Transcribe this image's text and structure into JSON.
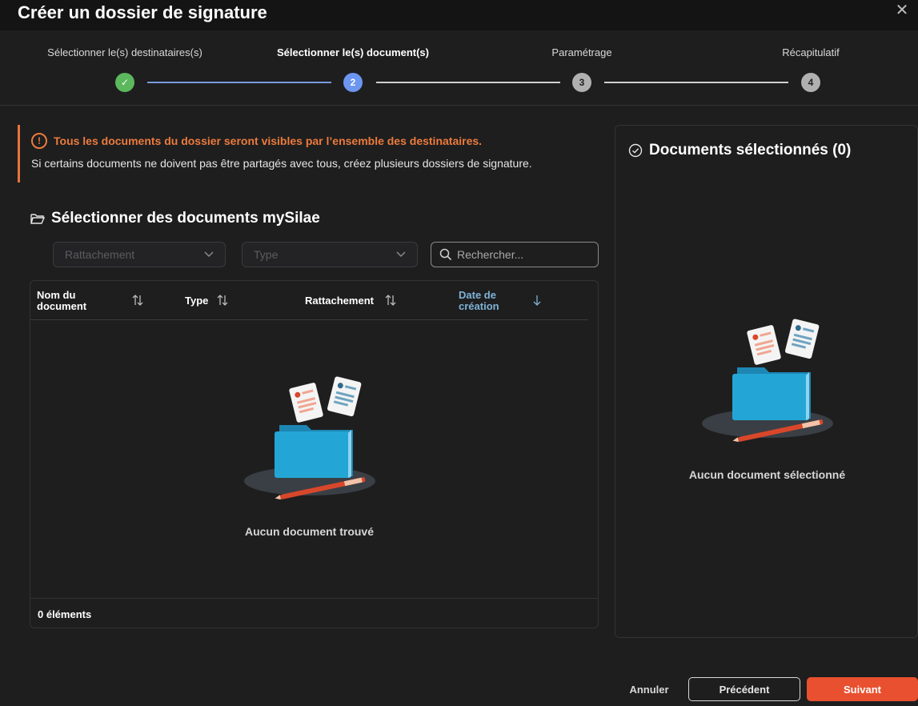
{
  "window": {
    "title": "Créer un dossier de signature",
    "close_icon": "close-icon"
  },
  "stepper": {
    "steps": [
      {
        "label": "Sélectionner le(s) destinataires(s)",
        "marker": "✓",
        "state": "done"
      },
      {
        "label": "Sélectionner le(s) document(s)",
        "marker": "2",
        "state": "active"
      },
      {
        "label": "Paramétrage",
        "marker": "3",
        "state": "todo"
      },
      {
        "label": "Récapitulatif",
        "marker": "4",
        "state": "todo"
      }
    ]
  },
  "warning": {
    "icon": "!",
    "title": "Tous les documents du dossier seront visibles par l’ensemble des destinataires.",
    "text": "Si certains documents ne doivent pas être partagés avec tous, créez plusieurs dossiers de signature."
  },
  "documents": {
    "title": "Sélectionner des documents mySilae",
    "filters": {
      "rattachement_placeholder": "Rattachement",
      "type_placeholder": "Type",
      "search_placeholder": "Rechercher..."
    },
    "columns": {
      "name_line1": "Nom du",
      "name_line2": "document",
      "type": "Type",
      "rattachement": "Rattachement",
      "date_line1": "Date de",
      "date_line2": "création"
    },
    "empty_text": "Aucun document trouvé",
    "count": "0 éléments"
  },
  "selected": {
    "title": "Documents sélectionnés (0)",
    "empty_text": "Aucun document sélectionné"
  },
  "footer": {
    "cancel": "Annuler",
    "previous": "Précédent",
    "next": "Suivant"
  },
  "colors": {
    "accent": "#e8502f",
    "warning": "#ec7b3c",
    "step_done": "#5cb85c",
    "step_active": "#6c96f0"
  }
}
